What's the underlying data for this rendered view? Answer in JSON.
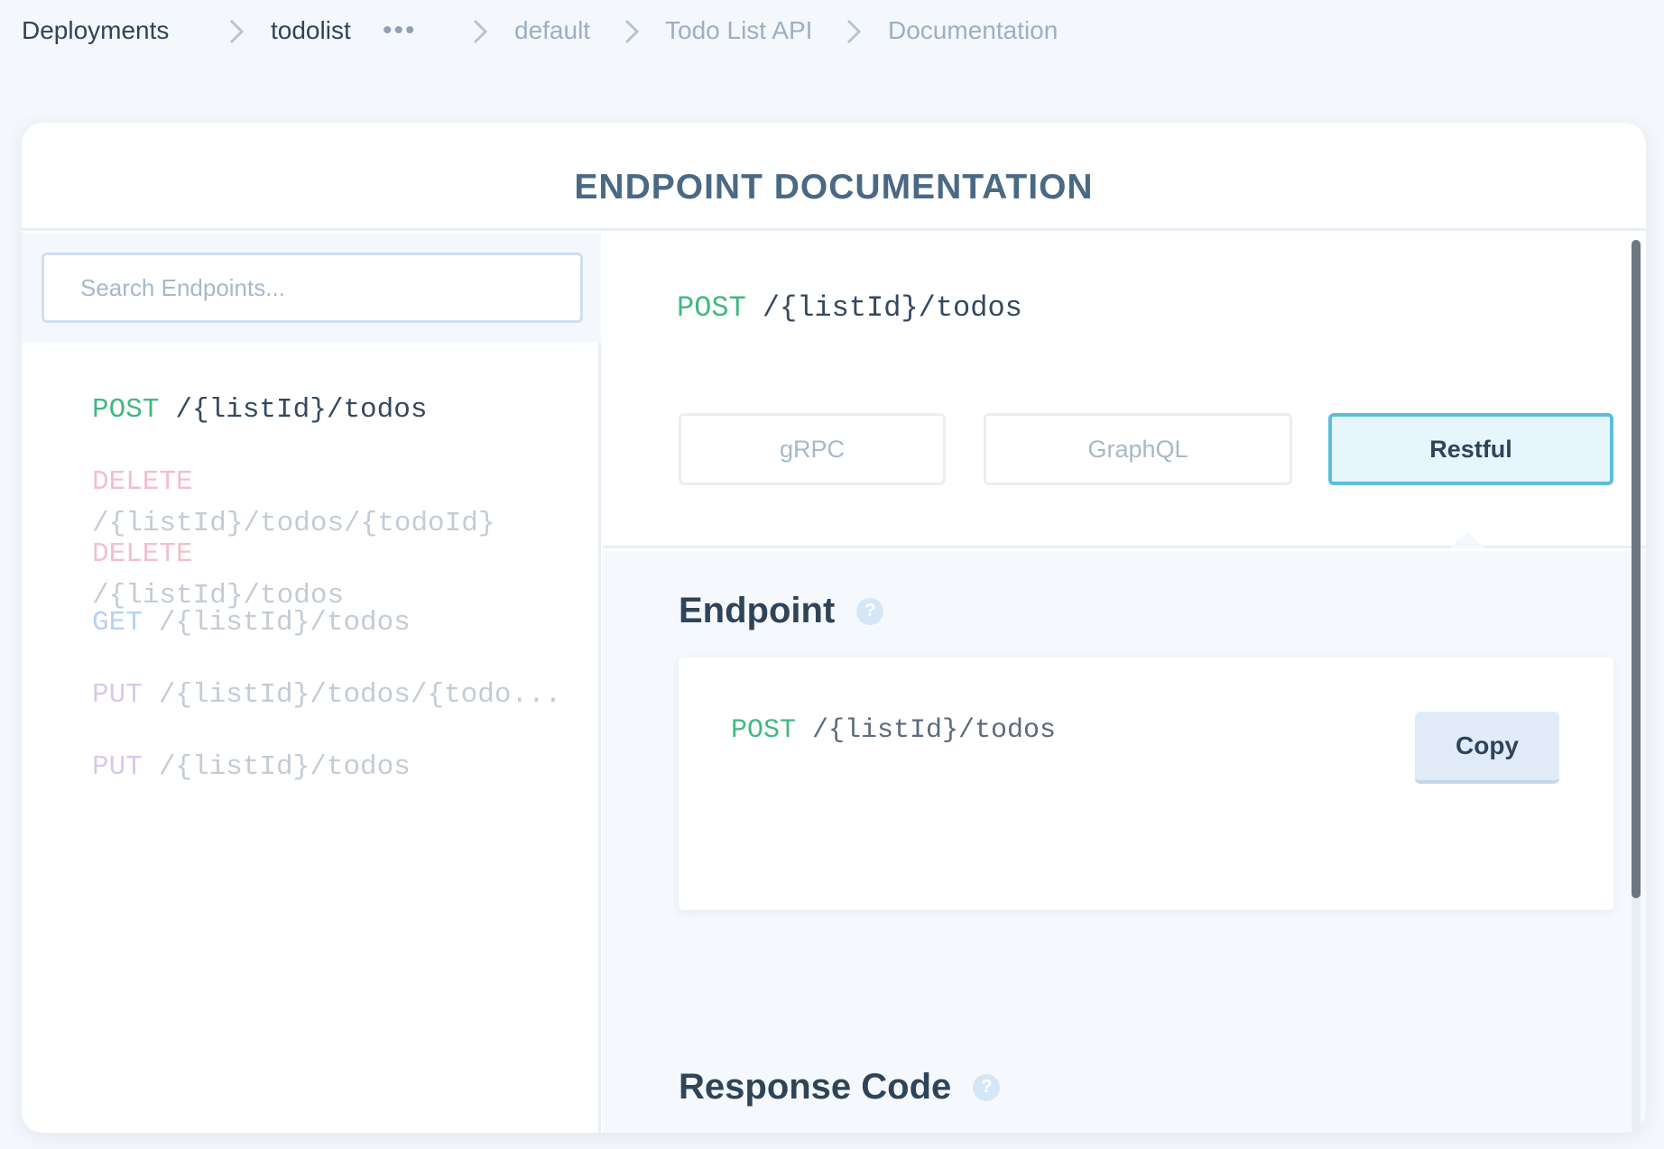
{
  "breadcrumb": {
    "items": [
      "Deployments",
      "todolist",
      "default",
      "Todo List API",
      "Documentation"
    ],
    "more": "•••"
  },
  "page": {
    "title": "ENDPOINT DOCUMENTATION"
  },
  "search": {
    "placeholder": "Search Endpoints..."
  },
  "endpoints": [
    {
      "method": "POST",
      "path": "/{listId}/todos"
    },
    {
      "method": "DELETE",
      "path": "/{listId}/todos/{todoId}"
    },
    {
      "method": "DELETE",
      "path": "/{listId}/todos"
    },
    {
      "method": "GET",
      "path": "/{listId}/todos"
    },
    {
      "method": "PUT",
      "path": "/{listId}/todos/{todo..."
    },
    {
      "method": "PUT",
      "path": "/{listId}/todos"
    }
  ],
  "selected": {
    "method": "POST",
    "path": "/{listId}/todos"
  },
  "protocols": {
    "items": [
      "gRPC",
      "GraphQL",
      "Restful"
    ],
    "active": "Restful"
  },
  "endpoint_section": {
    "title": "Endpoint",
    "help": "?",
    "method": "POST",
    "path": "/{listId}/todos",
    "copy_label": "Copy"
  },
  "response_section": {
    "title": "Response Code",
    "help": "?"
  },
  "colors": {
    "post": "#42b883",
    "delete": "#f2bfcc",
    "get": "#b5d2f2",
    "put": "#d8c8ec",
    "accent": "#5bbfdc",
    "title": "#4a6985"
  }
}
